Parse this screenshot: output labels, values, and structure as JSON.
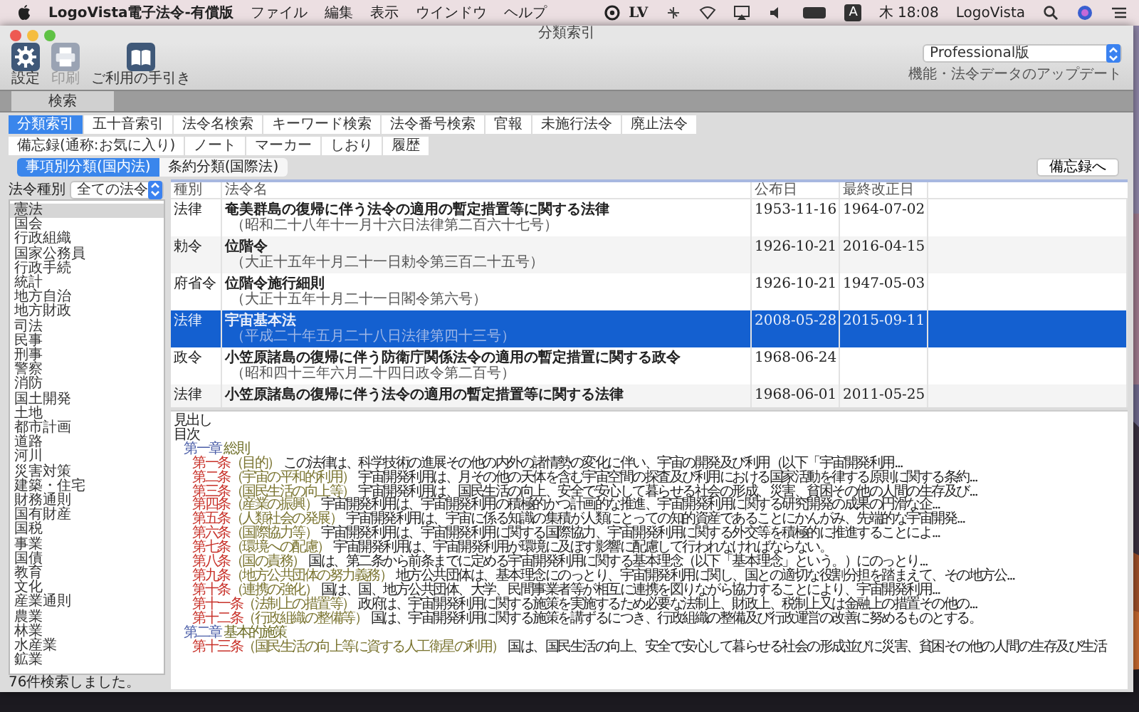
{
  "menubar": {
    "app": "LogoVista電子法令-有償版",
    "menus": [
      "ファイル",
      "編集",
      "表示",
      "ウインドウ",
      "ヘルプ"
    ],
    "status_text": "LV",
    "input_method": "A",
    "clock": "木 18:08",
    "user": "LogoVista"
  },
  "window": {
    "title": "分類索引"
  },
  "toolbar": [
    {
      "label": "設定",
      "kind": "gear",
      "disabled": false
    },
    {
      "label": "印刷",
      "kind": "printer",
      "disabled": true
    },
    {
      "label": "ご利用の手引き",
      "kind": "book",
      "disabled": false
    }
  ],
  "edition": {
    "value": "Professional版",
    "link": "機能・法令データのアップデート"
  },
  "mode_tabs": [
    {
      "label": "検索",
      "selected": true
    }
  ],
  "search_tab_rows": [
    [
      {
        "label": "分類索引",
        "selected": true
      },
      {
        "label": "五十音索引",
        "selected": false
      },
      {
        "label": "法令名検索",
        "selected": false
      },
      {
        "label": "キーワード検索",
        "selected": false
      },
      {
        "label": "法令番号検索",
        "selected": false
      },
      {
        "label": "官報",
        "selected": false
      },
      {
        "label": "未施行法令",
        "selected": false
      },
      {
        "label": "廃止法令",
        "selected": false
      }
    ],
    [
      {
        "label": "備忘録(通称:お気に入り)",
        "selected": false
      },
      {
        "label": "ノート",
        "selected": false
      },
      {
        "label": "マーカー",
        "selected": false
      },
      {
        "label": "しおり",
        "selected": false
      },
      {
        "label": "履歴",
        "selected": false
      }
    ]
  ],
  "category_tabs": [
    {
      "label": "事項別分類(国内法)",
      "selected": true
    },
    {
      "label": "条約分類(国際法)",
      "selected": false
    }
  ],
  "memo_button": "備忘録へ",
  "law_type": {
    "label": "法令種別",
    "value": "全ての法令"
  },
  "categories": [
    {
      "label": "憲法",
      "selected": true
    },
    {
      "label": "国会",
      "selected": false
    },
    {
      "label": "行政組織",
      "selected": false
    },
    {
      "label": "国家公務員",
      "selected": false
    },
    {
      "label": "行政手続",
      "selected": false
    },
    {
      "label": "統計",
      "selected": false
    },
    {
      "label": "地方自治",
      "selected": false
    },
    {
      "label": "地方財政",
      "selected": false
    },
    {
      "label": "司法",
      "selected": false
    },
    {
      "label": "民事",
      "selected": false
    },
    {
      "label": "刑事",
      "selected": false
    },
    {
      "label": "警察",
      "selected": false
    },
    {
      "label": "消防",
      "selected": false
    },
    {
      "label": "国土開発",
      "selected": false
    },
    {
      "label": "土地",
      "selected": false
    },
    {
      "label": "都市計画",
      "selected": false
    },
    {
      "label": "道路",
      "selected": false
    },
    {
      "label": "河川",
      "selected": false
    },
    {
      "label": "災害対策",
      "selected": false
    },
    {
      "label": "建築・住宅",
      "selected": false
    },
    {
      "label": "財務通則",
      "selected": false
    },
    {
      "label": "国有財産",
      "selected": false
    },
    {
      "label": "国税",
      "selected": false
    },
    {
      "label": "事業",
      "selected": false
    },
    {
      "label": "国債",
      "selected": false
    },
    {
      "label": "教育",
      "selected": false
    },
    {
      "label": "文化",
      "selected": false
    },
    {
      "label": "産業通則",
      "selected": false
    },
    {
      "label": "農業",
      "selected": false
    },
    {
      "label": "林業",
      "selected": false
    },
    {
      "label": "水産業",
      "selected": false
    },
    {
      "label": "鉱業",
      "selected": false
    }
  ],
  "status_bar": "76件検索しました。",
  "table": {
    "columns": [
      "種別",
      "法令名",
      "公布日",
      "最終改正日"
    ],
    "rows": [
      {
        "type": "法律",
        "name": "奄美群島の復帰に伴う法令の適用の暫定措置等に関する法律",
        "number": "（昭和二十八年十一月十六日法律第二百六十七号）",
        "promulgated": "1953-11-16",
        "amended": "1964-07-02",
        "selected": false
      },
      {
        "type": "勅令",
        "name": "位階令",
        "number": "（大正十五年十月二十一日勅令第三百二十五号）",
        "promulgated": "1926-10-21",
        "amended": "2016-04-15",
        "selected": false
      },
      {
        "type": "府省令",
        "name": "位階令施行細則",
        "number": "（大正十五年十月二十一日閣令第六号）",
        "promulgated": "1926-10-21",
        "amended": "1947-05-03",
        "selected": false
      },
      {
        "type": "法律",
        "name": "宇宙基本法",
        "number": "（平成二十年五月二十八日法律第四十三号）",
        "promulgated": "2008-05-28",
        "amended": "2015-09-11",
        "selected": true
      },
      {
        "type": "政令",
        "name": "小笠原諸島の復帰に伴う防衛庁関係法令の適用の暫定措置に関する政令",
        "number": "（昭和四十三年六月二十四日政令第二百号）",
        "promulgated": "1968-06-24",
        "selected": false
      },
      {
        "type": "法律",
        "name": "小笠原諸島の復帰に伴う法令の適用の暫定措置等に関する法律",
        "promulgated": "1968-06-01",
        "amended": "2011-05-25",
        "selected": false
      }
    ]
  },
  "toc": {
    "headings": [
      "見出し",
      "目次"
    ],
    "chapters": [
      {
        "number": "第一章",
        "title": "総則",
        "children": [
          {
            "number": "第一条",
            "caption": "（目的）",
            "text": "この法律は、科学技術の進展その他の内外の諸情勢の変化に伴い、宇宙の開発及び利用（以下「宇宙開発利用..."
          },
          {
            "number": "第二条",
            "caption": "（宇宙の平和的利用）",
            "text": "宇宙開発利用は、月その他の天体を含む宇宙空間の探査及び利用における国家活動を律する原則に関する条約..."
          },
          {
            "number": "第三条",
            "caption": "（国民生活の向上等）",
            "text": "宇宙開発利用は、国民生活の向上、安全で安心して暮らせる社会の形成、災害、貧困その他の人間の生存及び..."
          },
          {
            "number": "第四条",
            "caption": "（産業の振興）",
            "text": "宇宙開発利用は、宇宙開発利用の積極的かつ計画的な推進、宇宙開発利用に関する研究開発の成果の円滑な企..."
          },
          {
            "number": "第五条",
            "caption": "（人類社会の発展）",
            "text": "宇宙開発利用は、宇宙に係る知識の集積が人類にとっての知的資産であることにかんがみ、先端的な宇宙開発..."
          },
          {
            "number": "第六条",
            "caption": "（国際協力等）",
            "text": "宇宙開発利用は、宇宙開発利用に関する国際協力、宇宙開発利用に関する外交等を積極的に推進することによ..."
          },
          {
            "number": "第七条",
            "caption": "（環境への配慮）",
            "text": "宇宙開発利用は、宇宙開発利用が環境に及ぼす影響に配慮して行われなければならない。"
          },
          {
            "number": "第八条",
            "caption": "（国の責務）",
            "text": "国は、第二条から前条までに定める宇宙開発利用に関する基本理念（以下「基本理念」という。）にのっとり..."
          },
          {
            "number": "第九条",
            "caption": "（地方公共団体の努力義務）",
            "text": "地方公共団体は、基本理念にのっとり、宇宙開発利用に関し、国との適切な役割分担を踏まえて、その地方公..."
          },
          {
            "number": "第十条",
            "caption": "（連携の強化）",
            "text": "国は、国、地方公共団体、大学、民間事業者等が相互に連携を図りながら協力することにより、宇宙開発利用..."
          },
          {
            "number": "第十一条",
            "caption": "（法制上の措置等）",
            "text": "政府は、宇宙開発利用に関する施策を実施するため必要な法制上、財政上、税制上又は金融上の措置その他の..."
          },
          {
            "number": "第十二条",
            "caption": "（行政組織の整備等）",
            "text": "国は、宇宙開発利用に関する施策を講ずるにつき、行政組織の整備及び行政運営の改善に努めるものとする。"
          }
        ]
      },
      {
        "number": "第二章",
        "title": "基本的施策",
        "children": [
          {
            "number": "第十三条",
            "caption": "（国民生活の向上等に資する人工衛星の利用）",
            "text": "国は、国民生活の向上、安全で安心して暮らせる社会の形成並びに災害、貧困その他の人間の生存及び生活"
          }
        ]
      }
    ]
  }
}
